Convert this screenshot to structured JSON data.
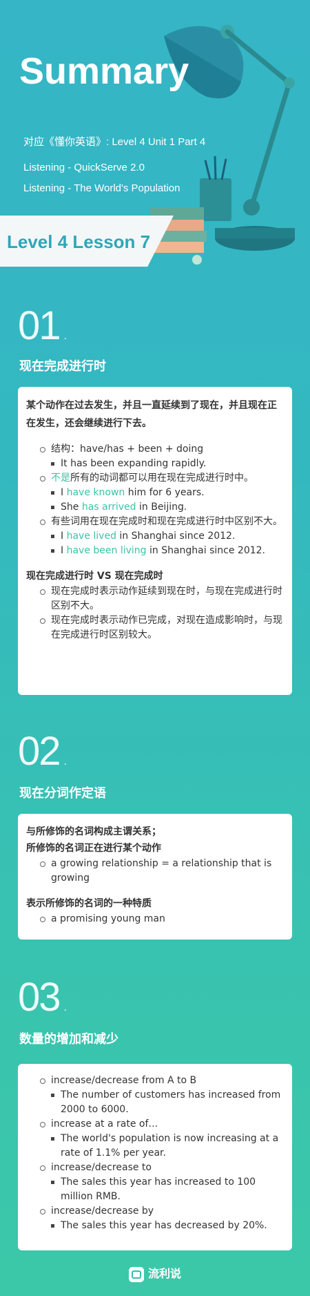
{
  "header": {
    "title": "Summary",
    "subtitle_1": "对应《懂你英语》: Level 4 Unit 1 Part 4",
    "subtitle_2": "Listening - QuickServe 2.0",
    "subtitle_3": "Listening - The World's Population",
    "banner": "Level 4 Lesson 7"
  },
  "sections": [
    {
      "number": "01",
      "title": "现在完成进行时",
      "lead": "某个动作在过去发生，并且一直延续到了现在，并且现在正在发生，还会继续进行下去。",
      "items": [
        {
          "text": "结构：have/has + been + doing"
        },
        {
          "text": "It has been expanding rapidly."
        },
        {
          "hl": "不是",
          "rest": "所有的动词都可以用在现在完成进行时中。"
        },
        {
          "pre": "I ",
          "hl": "have known",
          "post": " him for 6 years."
        },
        {
          "pre": "She ",
          "hl": "has arrived",
          "post": " in Beijing."
        },
        {
          "text": "有些词用在现在完成时和现在完成进行时中区别不大。"
        },
        {
          "pre": "I ",
          "hl": "have lived",
          "post": " in Shanghai since 2012."
        },
        {
          "pre": "I ",
          "hl": "have been living",
          "post": " in Shanghai since 2012."
        }
      ],
      "heading_2": "现在完成进行时 VS 现在完成时",
      "items_2": [
        "现在完成时表示动作延续到现在时，与现在完成进行时区别不大。",
        "现在完成时表示动作已完成，对现在造成影响时，与现在完成进行时区别较大。"
      ]
    },
    {
      "number": "02",
      "title": "现在分词作定语",
      "heading_1": "与所修饰的名词构成主谓关系；",
      "heading_2": "所修饰的名词正在进行某个动作",
      "item_1": "a growing relationship = a relationship that is growing",
      "heading_3": "表示所修饰的名词的一种特质",
      "item_2": "a promising young man"
    },
    {
      "number": "03",
      "title": "数量的增加和减少",
      "items": [
        {
          "level": 1,
          "text": "increase/decrease from A to B"
        },
        {
          "level": 2,
          "text": "The number of customers has increased from 2000 to 6000."
        },
        {
          "level": 1,
          "text": "increase at a rate of…"
        },
        {
          "level": 2,
          "text": "The world's population is now increasing at a rate of 1.1% per year."
        },
        {
          "level": 1,
          "text": "increase/decrease to"
        },
        {
          "level": 2,
          "text": "The sales this year has increased to 100 million RMB."
        },
        {
          "level": 1,
          "text": "increase/decrease by"
        },
        {
          "level": 2,
          "text": "The sales this year has decreased by 20%."
        }
      ]
    }
  ],
  "footer": {
    "brand": "流利说",
    "logo_icon": "liulishuo-logo-icon"
  },
  "colors": {
    "highlight": "#3cc2a8",
    "banner_text": "#2fa7b8"
  }
}
